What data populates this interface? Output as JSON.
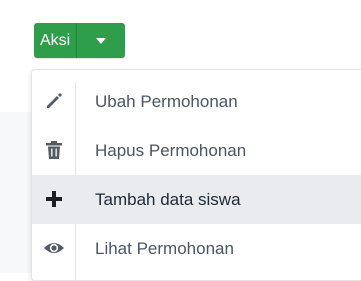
{
  "action_button": {
    "label": "Aksi",
    "caret_icon": "caret-down-icon",
    "color": "#2e9e4a"
  },
  "menu": {
    "items": [
      {
        "label": "Ubah Permohonan",
        "icon": "pencil-icon",
        "active": false
      },
      {
        "label": "Hapus Permohonan",
        "icon": "trash-icon",
        "active": false
      },
      {
        "label": "Tambah data siswa",
        "icon": "plus-icon",
        "active": true
      },
      {
        "label": "Lihat Permohonan",
        "icon": "eye-icon",
        "active": false
      }
    ]
  }
}
